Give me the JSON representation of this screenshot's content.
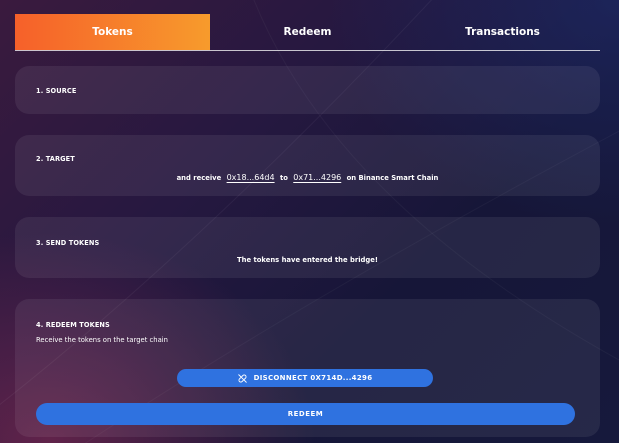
{
  "tabs": [
    {
      "label": "Tokens",
      "active": true
    },
    {
      "label": "Redeem",
      "active": false
    },
    {
      "label": "Transactions",
      "active": false
    }
  ],
  "source": {
    "title": "1. SOURCE"
  },
  "target": {
    "title": "2. TARGET",
    "receive_text": "and receive",
    "from_address": "0x18...64d4",
    "to_text": "to",
    "to_address": "0x71...4296",
    "chain_text": "on Binance Smart Chain"
  },
  "send": {
    "title": "3. SEND TOKENS",
    "status": "The tokens have entered the bridge!"
  },
  "redeem": {
    "title": "4. REDEEM TOKENS",
    "subtitle": "Receive the tokens on the target chain",
    "disconnect_label": "DISCONNECT 0X714D...4296",
    "disconnect_icon": "unlink-icon",
    "redeem_label": "REDEEM"
  },
  "colors": {
    "tab_active_start": "#f6602a",
    "tab_active_end": "#f79b2c",
    "button_blue": "#2f72e0"
  }
}
